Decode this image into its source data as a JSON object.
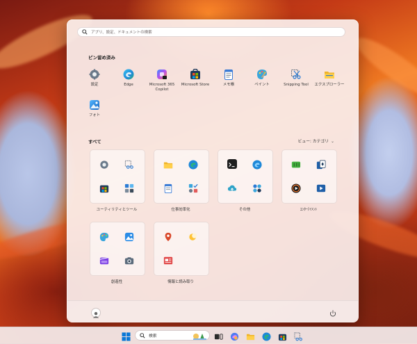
{
  "search": {
    "placeholder": "アプリ、設定、ドキュメントの検索"
  },
  "pinned": {
    "title": "ピン留め済み",
    "items": [
      {
        "label": "設定",
        "icon": "settings-icon"
      },
      {
        "label": "Edge",
        "icon": "edge-icon"
      },
      {
        "label": "Microsoft 365 Copilot",
        "icon": "copilot-icon"
      },
      {
        "label": "Microsoft Store",
        "icon": "store-icon"
      },
      {
        "label": "メモ帳",
        "icon": "notepad-icon"
      },
      {
        "label": "ペイント",
        "icon": "paint-icon"
      },
      {
        "label": "Snipping Tool",
        "icon": "snipping-tool-icon"
      },
      {
        "label": "エクスプローラー",
        "icon": "file-explorer-icon"
      },
      {
        "label": "フォト",
        "icon": "photos-icon"
      }
    ]
  },
  "all": {
    "title": "すべて",
    "view_label": "ビュー: カテゴリ",
    "folders": [
      {
        "label": "ユーティリティとツール"
      },
      {
        "label": "仕事効率化"
      },
      {
        "label": "その他"
      },
      {
        "label": "ｴﾝﾀｰﾃｲﾒﾝﾄ"
      },
      {
        "label": "創造性"
      },
      {
        "label": "情報と読み取り"
      }
    ]
  },
  "taskbar": {
    "search_label": "検索"
  },
  "colors": {
    "accent": "#0067c0",
    "wallpaper": "#d9481a"
  }
}
